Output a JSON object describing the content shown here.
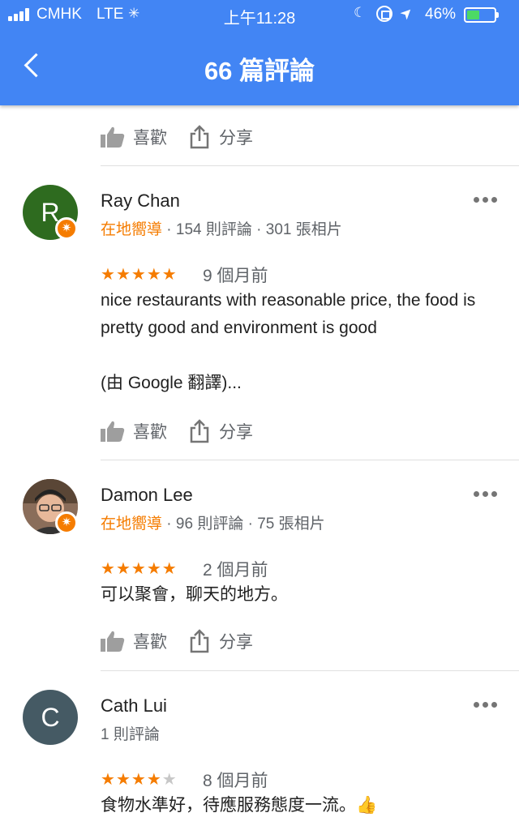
{
  "status_bar": {
    "carrier": "CMHK",
    "network": "LTE",
    "time": "上午11:28",
    "battery_percent": "46%",
    "battery_level": 0.46
  },
  "header": {
    "title": "66 篇評論",
    "back_icon": "chevron-left-icon"
  },
  "actions": {
    "like_label": "喜歡",
    "share_label": "分享"
  },
  "reviews": [
    {
      "avatar_letter": "R",
      "avatar_color": "#2e6b1f",
      "name": "Ray Chan",
      "local_guide": "在地嚮導",
      "review_count": "154 則評論",
      "photo_count": "301 張相片",
      "rating": 5,
      "time": "9 個月前",
      "text": "nice restaurants with reasonable price, the food is pretty good and environment is good\n\n(由 Google 翻譯)..."
    },
    {
      "avatar_letter": "",
      "avatar_color": "#8a6d5a",
      "name": "Damon Lee",
      "local_guide": "在地嚮導",
      "review_count": "96 則評論",
      "photo_count": "75 張相片",
      "rating": 5,
      "time": "2 個月前",
      "text": "可以聚會，聊天的地方。"
    },
    {
      "avatar_letter": "C",
      "avatar_color": "#455a64",
      "name": "Cath Lui",
      "review_count": "1 則評論",
      "rating": 4,
      "time": "8 個月前",
      "text": "食物水準好，待應服務態度一流。👍"
    }
  ],
  "colors": {
    "header_blue": "#4285f4",
    "accent_orange": "#f57c00"
  }
}
